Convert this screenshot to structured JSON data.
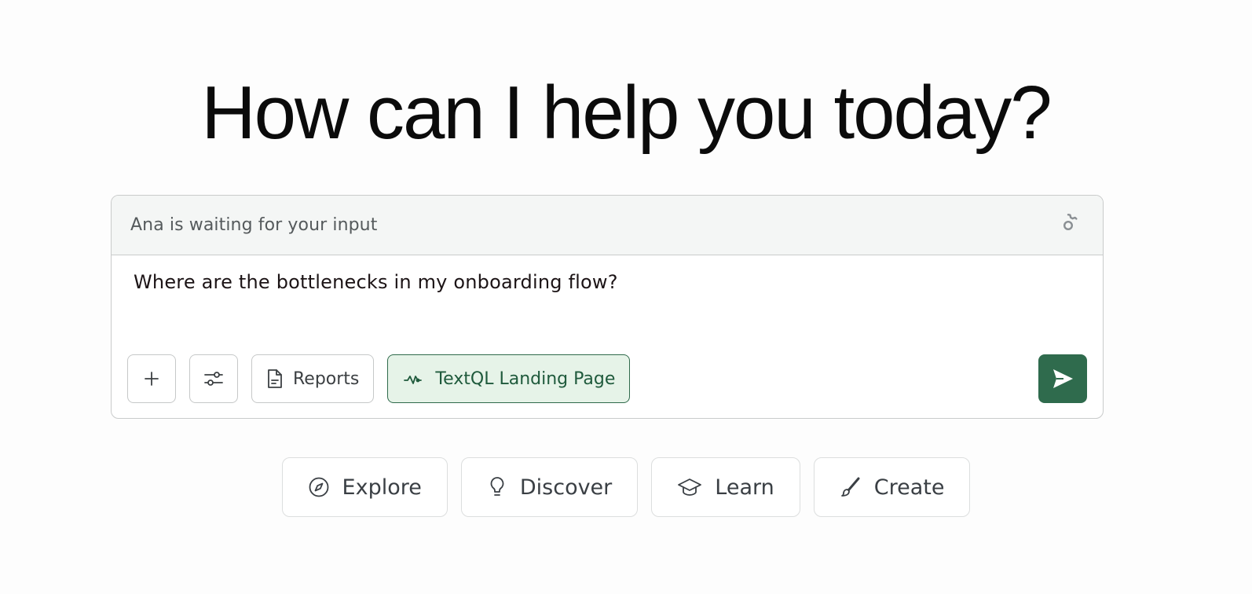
{
  "headline": "How can I help you today?",
  "chat": {
    "status": "Ana is waiting for your input",
    "prompt": "Where are the bottlenecks in my onboarding flow?",
    "toolbar": {
      "reports_label": "Reports",
      "context_label": "TextQL Landing Page"
    }
  },
  "quick_actions": [
    {
      "label": "Explore",
      "icon": "compass-icon"
    },
    {
      "label": "Discover",
      "icon": "lightbulb-icon"
    },
    {
      "label": "Learn",
      "icon": "graduation-cap-icon"
    },
    {
      "label": "Create",
      "icon": "paintbrush-icon"
    }
  ],
  "colors": {
    "accent": "#2f6b4d",
    "accent_light": "#e6f3e8",
    "header_bg": "#f4f6f5",
    "border": "#c9cbcb"
  }
}
